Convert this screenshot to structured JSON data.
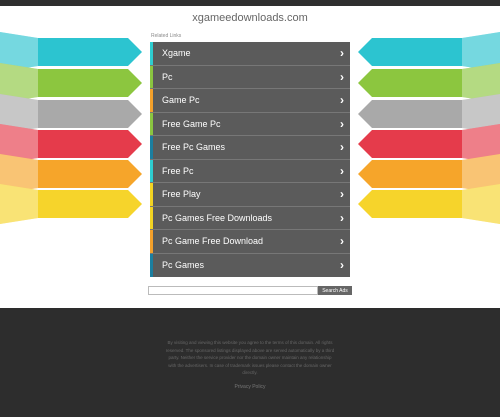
{
  "site": {
    "domain": "xgameedownloads.com"
  },
  "related_label": "Related Links",
  "menu": {
    "items": [
      {
        "label": "Xgame",
        "bar_color": "#2ecdd0"
      },
      {
        "label": "Pc",
        "bar_color": "#8ac540"
      },
      {
        "label": "Game Pc",
        "bar_color": "#f4a12b"
      },
      {
        "label": "Free Game Pc",
        "bar_color": "#8ac540"
      },
      {
        "label": "Free Pc Games",
        "bar_color": "#1b7fa0"
      },
      {
        "label": "Free Pc",
        "bar_color": "#2ecdd0"
      },
      {
        "label": "Free Play",
        "bar_color": "#f2d322"
      },
      {
        "label": "Pc Games Free Downloads",
        "bar_color": "#f2d322"
      },
      {
        "label": "Pc Game Free Download",
        "bar_color": "#f4a12b"
      },
      {
        "label": "Pc Games",
        "bar_color": "#1b7fa0"
      }
    ],
    "arrow_icon": "chevron-right-icon"
  },
  "search": {
    "button_label": "Search Ads",
    "placeholder": ""
  },
  "footer": {
    "text": "By visiting and viewing this website you agree to the terms of this domain. All rights reserved. The sponsored listings displayed above are served automatically by a third party. Neither the service provider nor the domain owner maintain any relationship with the advertisers. In case of trademark issues please contact the domain owner directly.",
    "link": "Privacy Policy"
  },
  "banners": {
    "left": [
      "#2cc4d0",
      "#8cc63f",
      "#a9a9a9",
      "#e53b4b",
      "#f6a52a",
      "#f6d42b"
    ],
    "right": [
      "#2cc4d0",
      "#8cc63f",
      "#a9a9a9",
      "#e53b4b",
      "#f6a52a",
      "#f6d42b"
    ]
  },
  "colors": {
    "menu_bg": "#5b5b5b",
    "topbar": "#2f2f2f",
    "footer_bg": "#2d2d2d"
  }
}
